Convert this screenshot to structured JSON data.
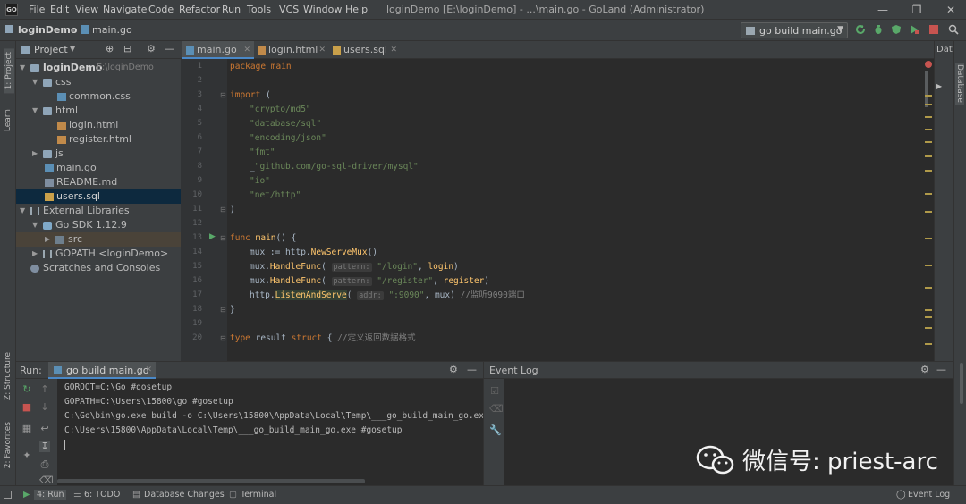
{
  "titlebar": {
    "app_icon": "GO",
    "menus": [
      "File",
      "Edit",
      "View",
      "Navigate",
      "Code",
      "Refactor",
      "Run",
      "Tools",
      "VCS",
      "Window",
      "Help"
    ],
    "title": "loginDemo [E:\\loginDemo] - ...\\main.go - GoLand (Administrator)"
  },
  "navbar": {
    "project": "loginDemo",
    "file": "main.go",
    "run_config": "go build main.go"
  },
  "left_stripe": {
    "project": "1: Project",
    "learn": "Learn",
    "structure": "Z: Structure",
    "favorites": "2: Favorites"
  },
  "project_panel": {
    "header": "Project",
    "tree": [
      {
        "label": "loginDemo",
        "extra": "E:\\loginDemo"
      },
      {
        "label": "css"
      },
      {
        "label": "common.css"
      },
      {
        "label": "html"
      },
      {
        "label": "login.html"
      },
      {
        "label": "register.html"
      },
      {
        "label": "js"
      },
      {
        "label": "main.go"
      },
      {
        "label": "README.md"
      },
      {
        "label": "users.sql"
      },
      {
        "label": "External Libraries"
      },
      {
        "label": "Go SDK 1.12.9"
      },
      {
        "label": "src"
      },
      {
        "label": "GOPATH <loginDemo>"
      },
      {
        "label": "Scratches and Consoles"
      }
    ]
  },
  "editor": {
    "tabs": [
      "main.go",
      "login.html",
      "users.sql"
    ],
    "line_numbers": [
      "1",
      "2",
      "3",
      "4",
      "5",
      "6",
      "7",
      "8",
      "9",
      "10",
      "11",
      "12",
      "13",
      "14",
      "15",
      "16",
      "17",
      "18",
      "19",
      "20"
    ],
    "lines": {
      "l1": "package main",
      "l3a": "import",
      "l3b": " (",
      "l4": "\"crypto/md5\"",
      "l5": "\"database/sql\"",
      "l6": "\"encoding/json\"",
      "l7": "\"fmt\"",
      "l8a": "_",
      "l8b": "\"github.com/go-sql-driver/mysql\"",
      "l9": "\"io\"",
      "l10": "\"net/http\"",
      "l11": ")",
      "l13a": "func",
      "l13b": "main",
      "l13c": "() {",
      "l14a": "mux := http.",
      "l14b": "NewServeMux",
      "l14c": "()",
      "l15a": "mux.",
      "l15b": "HandleFunc",
      "l15c": "( ",
      "l15d": "pattern:",
      "l15e": " \"/login\"",
      "l15f": ", ",
      "l15g": "login",
      "l15h": ")",
      "l16a": "mux.",
      "l16b": "HandleFunc",
      "l16c": "( ",
      "l16d": "pattern:",
      "l16e": " \"/register\"",
      "l16f": ", ",
      "l16g": "register",
      "l16h": ")",
      "l17a": "http.",
      "l17b": "ListenAndServe",
      "l17c": "( ",
      "l17d": "addr:",
      "l17e": " \":9090\"",
      "l17f": ", mux) ",
      "l17g": "//监听9090端口",
      "l18": "}",
      "l20a": "type",
      "l20b": " result ",
      "l20c": "struct",
      "l20d": " { ",
      "l20e": "//定义返回数据格式"
    }
  },
  "right_stripe": {
    "database_short": "Data",
    "database": "Database"
  },
  "run_panel": {
    "label": "Run:",
    "tab": "go build main.go",
    "output": [
      "GOROOT=C:\\Go #gosetup",
      "GOPATH=C:\\Users\\15800\\go #gosetup",
      "C:\\Go\\bin\\go.exe build -o C:\\Users\\15800\\AppData\\Local\\Temp\\___go_build_main_go.exe E",
      "C:\\Users\\15800\\AppData\\Local\\Temp\\___go_build_main_go.exe #gosetup"
    ]
  },
  "event_log": {
    "title": "Event Log"
  },
  "statusbar": {
    "run": "4: Run",
    "todo": "6: TODO",
    "db_changes": "Database Changes",
    "terminal": "Terminal",
    "event_log": "Event Log"
  },
  "watermark": {
    "text": "微信号: priest-arc"
  },
  "colors": {
    "accent": "#4a88c7",
    "keyword": "#cc7832",
    "string": "#6a8759",
    "function": "#ffc66d",
    "comment": "#808080"
  }
}
